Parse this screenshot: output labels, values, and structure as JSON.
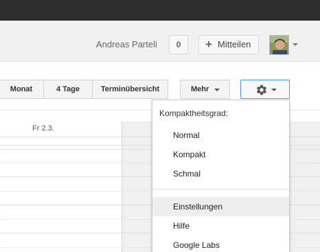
{
  "header": {
    "user_name": "Andreas Parteli",
    "notification_count": "0",
    "share_label": "Mitteilen"
  },
  "toolbar": {
    "views": [
      "Monat",
      "4 Tage",
      "Terminübersicht"
    ],
    "more_label": "Mehr"
  },
  "calendar": {
    "day_header": "Fr 2.3."
  },
  "settings_menu": {
    "heading": "Kompaktheitsgrad:",
    "density_options": [
      "Normal",
      "Kompakt",
      "Schmal"
    ],
    "items": [
      "Einstellungen",
      "Hilfe",
      "Google Labs"
    ],
    "highlighted_item": "Einstellungen"
  },
  "icons": {
    "share": "plus-icon",
    "settings": "gear-icon",
    "dropdown": "caret-down-icon"
  },
  "colors": {
    "topbar": "#2d2d2d",
    "header_bg": "#f1f1f1",
    "focus_border": "#4d90fe",
    "menu_hover": "#eeeeee"
  }
}
